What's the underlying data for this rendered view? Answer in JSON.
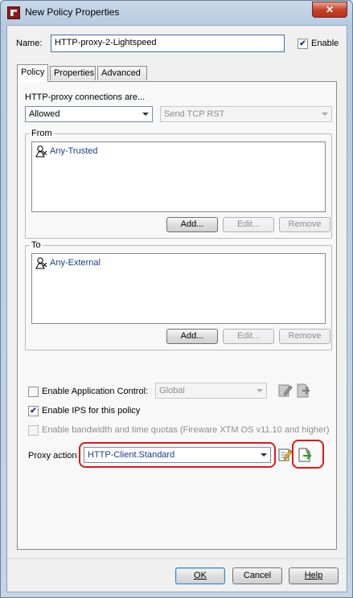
{
  "window": {
    "title": "New Policy Properties",
    "close_label": "✕"
  },
  "name_row": {
    "label": "Name:",
    "value": "HTTP-proxy-2-Lightspeed",
    "enable_label": "Enable",
    "enable_checked": true
  },
  "tabs": [
    {
      "label": "Policy",
      "active": true
    },
    {
      "label": "Properties",
      "active": false
    },
    {
      "label": "Advanced",
      "active": false
    }
  ],
  "policy": {
    "connections_label": "HTTP-proxy connections are...",
    "action_value": "Allowed",
    "reject_value": "Send TCP RST",
    "from": {
      "legend": "From",
      "items": [
        "Any-Trusted"
      ],
      "add_label": "Add...",
      "edit_label": "Edit...",
      "remove_label": "Remove"
    },
    "to": {
      "legend": "To",
      "items": [
        "Any-External"
      ],
      "add_label": "Add...",
      "edit_label": "Edit...",
      "remove_label": "Remove"
    },
    "app_control": {
      "label": "Enable Application Control:",
      "checked": false,
      "value": "Global"
    },
    "ips": {
      "label": "Enable IPS for this policy",
      "checked": true
    },
    "bandwidth": {
      "label": "Enable bandwidth and time quotas (Fireware XTM OS v11.10 and higher)",
      "checked": false
    },
    "proxy_action": {
      "label": "Proxy action",
      "value": "HTTP-Client.Standard"
    }
  },
  "footer": {
    "ok_label": "OK",
    "cancel_label": "Cancel",
    "help_label": "Help"
  },
  "colors": {
    "highlight": "#d9191c",
    "link_text": "#1a3b8f",
    "checkmark": "#1d3a7a"
  }
}
